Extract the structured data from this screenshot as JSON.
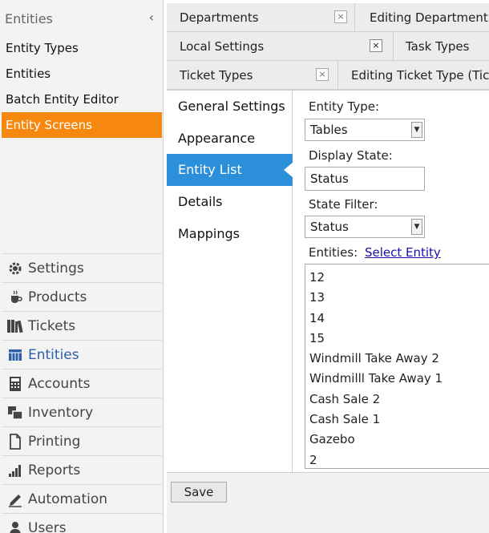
{
  "left_panel": {
    "header": "Entities",
    "collapse_glyph": "‹",
    "items": [
      {
        "label": "Entity Types"
      },
      {
        "label": "Entities"
      },
      {
        "label": "Batch Entity Editor"
      },
      {
        "label": "Entity Screens"
      }
    ],
    "active_item": "Entity Screens"
  },
  "nav": {
    "items": [
      {
        "label": "Settings",
        "icon": "gear-icon"
      },
      {
        "label": "Products",
        "icon": "coffee-cup-icon"
      },
      {
        "label": "Tickets",
        "icon": "books-icon"
      },
      {
        "label": "Entities",
        "icon": "table-grid-icon"
      },
      {
        "label": "Accounts",
        "icon": "calculator-icon"
      },
      {
        "label": "Inventory",
        "icon": "stack-icon"
      },
      {
        "label": "Printing",
        "icon": "document-icon"
      },
      {
        "label": "Reports",
        "icon": "bar-chart-icon"
      },
      {
        "label": "Automation",
        "icon": "pen-icon"
      },
      {
        "label": "Users",
        "icon": "user-icon"
      }
    ],
    "active_item": "Entities",
    "accent": "#2e5fa8"
  },
  "tabs": {
    "row1": [
      {
        "label": "Departments",
        "close": "×"
      },
      {
        "label": "Editing Department (Ne"
      }
    ],
    "row2": [
      {
        "label": "Local Settings",
        "close": "×"
      },
      {
        "label": "Task Types"
      }
    ],
    "row3": [
      {
        "label": "Ticket Types",
        "close": "×"
      },
      {
        "label": "Editing Ticket Type (Ticke"
      }
    ]
  },
  "subnav": {
    "items": [
      {
        "label": "General Settings"
      },
      {
        "label": "Appearance"
      },
      {
        "label": "Entity List"
      },
      {
        "label": "Details"
      },
      {
        "label": "Mappings"
      }
    ],
    "active_item": "Entity List"
  },
  "form": {
    "entity_type_label": "Entity Type:",
    "entity_type_value": "Tables",
    "display_state_label": "Display State:",
    "display_state_value": "Status",
    "state_filter_label": "State Filter:",
    "state_filter_value": "Status",
    "entities_label": "Entities:",
    "select_entity_link": "Select Entity",
    "entities": [
      "12",
      "13",
      "14",
      "15",
      "Windmill Take Away 2",
      "Windmilll Take Away 1",
      "Cash Sale 2",
      "Cash Sale 1",
      "Gazebo",
      "2"
    ]
  },
  "footer": {
    "save_label": "Save"
  },
  "colors": {
    "active_orange": "#f7880f",
    "active_blue": "#2b8fd9",
    "link": "#1a0dab"
  }
}
